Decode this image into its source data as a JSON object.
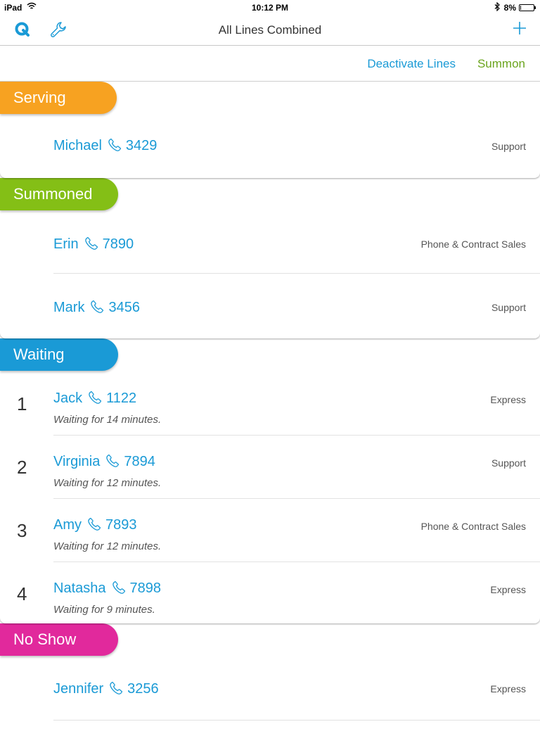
{
  "status_bar": {
    "carrier": "iPad",
    "time": "10:12 PM",
    "battery": "8%",
    "battery_level": 0.08
  },
  "nav": {
    "title": "All Lines Combined"
  },
  "actions": {
    "deactivate": "Deactivate Lines",
    "summon": "Summon"
  },
  "colors": {
    "accent": "#1a9ad6",
    "summon_text": "#6aa41d",
    "serving": "#f7a221",
    "summoned": "#84bf16",
    "waiting": "#1a9ad6",
    "no_show": "#e1299c"
  },
  "icons": {
    "logo": "q-logo-icon",
    "settings": "wrench-icon",
    "add": "plus-icon",
    "phone": "phone-icon",
    "wifi": "wifi-icon",
    "bluetooth": "bluetooth-icon",
    "battery": "battery-icon"
  },
  "sections": {
    "serving": {
      "label": "Serving",
      "rows": [
        {
          "name": "Michael",
          "phone": "3429",
          "dept": "Support"
        }
      ]
    },
    "summoned": {
      "label": "Summoned",
      "rows": [
        {
          "name": "Erin",
          "phone": "7890",
          "dept": "Phone & Contract Sales"
        },
        {
          "name": "Mark",
          "phone": "3456",
          "dept": "Support"
        }
      ]
    },
    "waiting": {
      "label": "Waiting",
      "rows": [
        {
          "num": "1",
          "name": "Jack",
          "phone": "1122",
          "dept": "Express",
          "wait": "Waiting for 14 minutes."
        },
        {
          "num": "2",
          "name": "Virginia",
          "phone": "7894",
          "dept": "Support",
          "wait": "Waiting for 12 minutes."
        },
        {
          "num": "3",
          "name": "Amy",
          "phone": "7893",
          "dept": "Phone & Contract Sales",
          "wait": "Waiting for 12 minutes."
        },
        {
          "num": "4",
          "name": "Natasha",
          "phone": "7898",
          "dept": "Express",
          "wait": "Waiting for 9 minutes."
        }
      ]
    },
    "no_show": {
      "label": "No Show",
      "rows": [
        {
          "name": "Jennifer",
          "phone": "3256",
          "dept": "Express"
        }
      ]
    }
  }
}
